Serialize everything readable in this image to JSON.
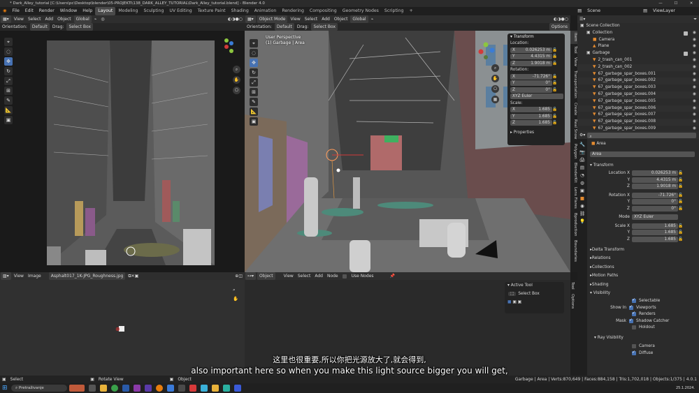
{
  "window": {
    "title": "* Dark_Alley_tutorial [C:\\Users\\pc\\Desktop\\blender\\05-PROJEKTI\\138_DARK_ALLEY_TUTORIAL\\Dark_Alley_tutorial.blend] - Blender 4.0"
  },
  "menu": [
    "File",
    "Edit",
    "Render",
    "Window",
    "Help"
  ],
  "workspaces": [
    "Layout",
    "Modeling",
    "Sculpting",
    "UV Editing",
    "Texture Paint",
    "Shading",
    "Animation",
    "Rendering",
    "Compositing",
    "Geometry Nodes",
    "Scripting",
    "+"
  ],
  "scene": {
    "label": "Scene",
    "viewlayer": "ViewLayer"
  },
  "left_vp": {
    "header": [
      "View",
      "Select",
      "Add",
      "Object"
    ],
    "orientation": "Orientation:",
    "orient_val": "Default",
    "drag": "Drag:",
    "drag_val": "Select Box",
    "global": "Global"
  },
  "main_vp": {
    "mode": "Object Mode",
    "header": [
      "View",
      "Select",
      "Add",
      "Object"
    ],
    "global": "Global",
    "orientation": "Orientation:",
    "orient_val": "Default",
    "drag": "Drag:",
    "drag_val": "Select Box",
    "options": "Options",
    "persp": "User Perspective",
    "obj": "(1) Garbage | Area"
  },
  "npanel": {
    "title": "Transform",
    "location": "Location:",
    "loc": [
      [
        "X",
        "0.026253 m"
      ],
      [
        "Y",
        "4.4315 m"
      ],
      [
        "Z",
        "1.9018 m"
      ]
    ],
    "rotation": "Rotation:",
    "rot": [
      [
        "X",
        "-71.726°"
      ],
      [
        "Y",
        "0°"
      ],
      [
        "Z",
        "0°"
      ]
    ],
    "euler": "XYZ Euler",
    "scale": "Scale:",
    "scl": [
      [
        "X",
        "1.685"
      ],
      [
        "Y",
        "1.685"
      ],
      [
        "Z",
        "1.685"
      ]
    ],
    "properties": "Properties"
  },
  "ntabs": [
    "Item",
    "Tool",
    "View",
    "Transportation",
    "Create",
    "Real Snow",
    "Polygon",
    "BlenderKit",
    "Lens Flares",
    "Bproduction",
    "Boundaries"
  ],
  "outliner": {
    "rows": [
      {
        "label": "Scene Collection",
        "indent": 0,
        "icon": "▣"
      },
      {
        "label": "Collection",
        "indent": 1,
        "icon": "▣"
      },
      {
        "label": "Camera",
        "indent": 2,
        "icon": "■"
      },
      {
        "label": "Plane",
        "indent": 2,
        "icon": "▲"
      },
      {
        "label": "Garbage",
        "indent": 1,
        "icon": "▣"
      },
      {
        "label": "2_trash_can_001",
        "indent": 2,
        "icon": "▼"
      },
      {
        "label": "2_trash_can_002",
        "indent": 2,
        "icon": "▼"
      },
      {
        "label": "67_garbage_spar_boxes.001",
        "indent": 2,
        "icon": "▼"
      },
      {
        "label": "67_garbage_spar_boxes.002",
        "indent": 2,
        "icon": "▼"
      },
      {
        "label": "67_garbage_spar_boxes.003",
        "indent": 2,
        "icon": "▼"
      },
      {
        "label": "67_garbage_spar_boxes.004",
        "indent": 2,
        "icon": "▼"
      },
      {
        "label": "67_garbage_spar_boxes.005",
        "indent": 2,
        "icon": "▼"
      },
      {
        "label": "67_garbage_spar_boxes.006",
        "indent": 2,
        "icon": "▼"
      },
      {
        "label": "67_garbage_spar_boxes.007",
        "indent": 2,
        "icon": "▼"
      },
      {
        "label": "67_garbage_spar_boxes.008",
        "indent": 2,
        "icon": "▼"
      },
      {
        "label": "67_garbage_spar_boxes.009",
        "indent": 2,
        "icon": "▼"
      }
    ]
  },
  "props": {
    "obj_name": "Area",
    "obj_field": "Area",
    "transform": "Transform",
    "loc": [
      [
        "Location X",
        "0.026253 m"
      ],
      [
        "Y",
        "4.4315 m"
      ],
      [
        "Z",
        "1.9018 m"
      ]
    ],
    "rot": [
      [
        "Rotation X",
        "-71.726°"
      ],
      [
        "Y",
        "0°"
      ],
      [
        "Z",
        "0°"
      ]
    ],
    "mode_l": "Mode",
    "mode_v": "XYZ Euler",
    "scl": [
      [
        "Scale X",
        "1.685"
      ],
      [
        "Y",
        "1.685"
      ],
      [
        "Z",
        "1.685"
      ]
    ],
    "sections": [
      "Delta Transform",
      "Relations",
      "Collections",
      "Motion Paths",
      "Shading"
    ],
    "visibility": "Visibility",
    "selectable": "Selectable",
    "show_in": "Show In",
    "viewports": "Viewports",
    "renders": "Renders",
    "mask": "Mask",
    "shadow_catcher": "Shadow Catcher",
    "holdout": "Holdout",
    "ray": "Ray Visibility",
    "camera": "Camera",
    "diffuse": "Diffuse"
  },
  "image_editor": {
    "header": [
      "View",
      "Image"
    ],
    "file": "Asphalt017_1K-JPG_Roughness.jpg"
  },
  "node_editor": {
    "object": "Object",
    "header": [
      "View",
      "Select",
      "Add",
      "Node"
    ],
    "use_nodes": "Use Nodes",
    "active_tool": "Active Tool",
    "select_box": "Select Box",
    "tabs": [
      "Tool",
      "Options"
    ]
  },
  "status": {
    "select": "Select",
    "rotate": "Rotate View",
    "object": "Object",
    "stats": "Garbage | Area | Verts:870,649 | Faces:884,158 | Tris:1,702,018 | Objects:1/375 | 4.0.1"
  },
  "subtitles": {
    "cn": "这里也很重要,所以你把光源放大了,就会得到,",
    "en": "also important here so when you make this light source bigger you will get,"
  },
  "taskbar": {
    "search": "Pretraživanje",
    "date": "25.1.2024."
  }
}
